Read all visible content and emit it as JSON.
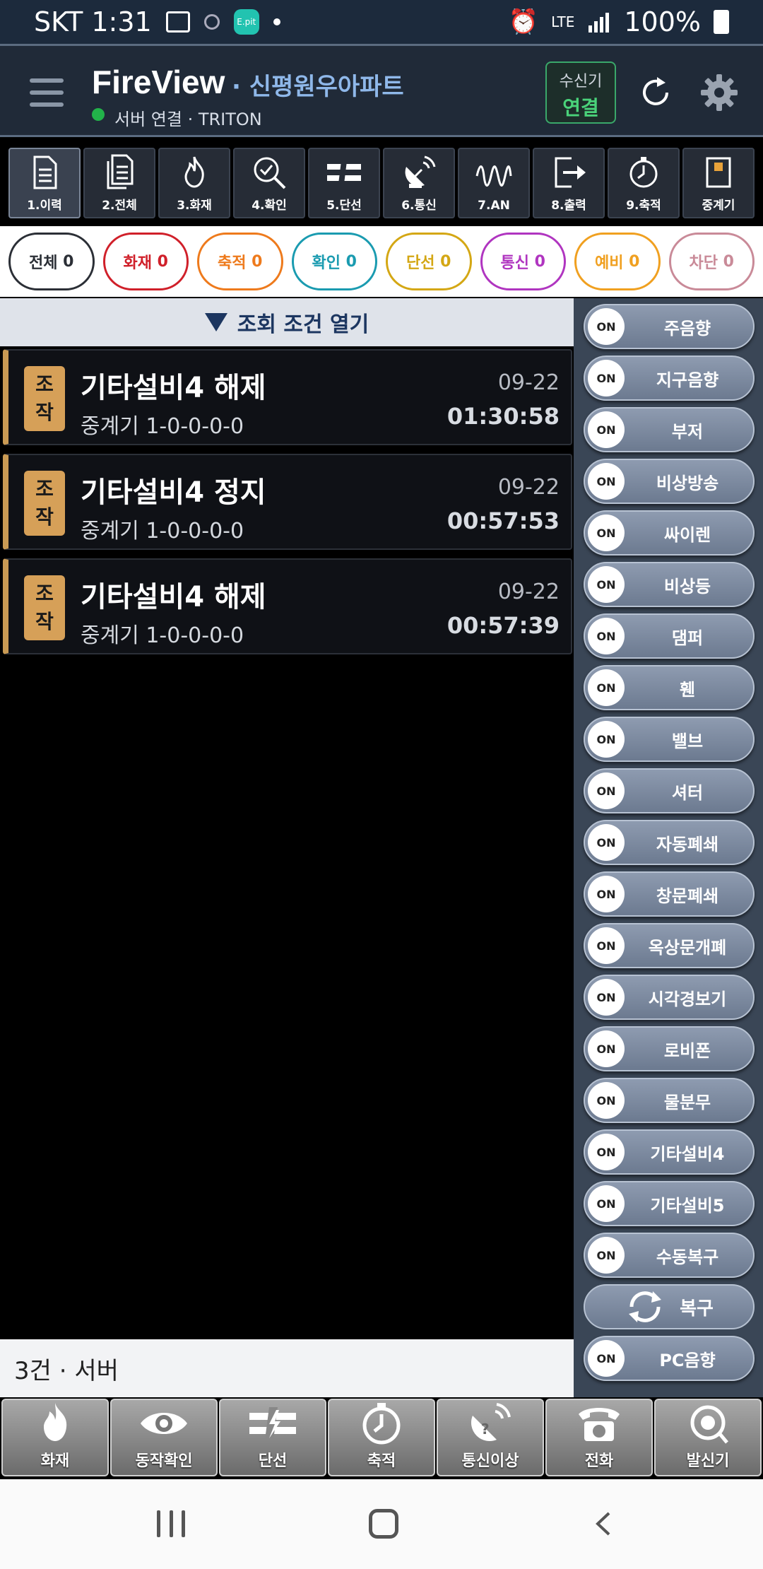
{
  "status_bar": {
    "carrier_time": "SKT 1:31",
    "app_badge": "E.pit",
    "network": "LTE",
    "battery": "100%"
  },
  "header": {
    "title": "FireView",
    "site": "· 신평원우아파트",
    "connection": "서버 연결 · TRITON",
    "receiver_line1": "수신기",
    "receiver_line2": "연결"
  },
  "toolbar": [
    {
      "label": "1.이력",
      "icon": "document-icon",
      "active": true
    },
    {
      "label": "2.전체",
      "icon": "documents-icon",
      "active": false
    },
    {
      "label": "3.화재",
      "icon": "fire-icon",
      "active": false
    },
    {
      "label": "4.확인",
      "icon": "check-search-icon",
      "active": false
    },
    {
      "label": "5.단선",
      "icon": "broken-line-icon",
      "active": false
    },
    {
      "label": "6.통신",
      "icon": "satellite-dish-icon",
      "active": false
    },
    {
      "label": "7.AN",
      "icon": "wave-icon",
      "active": false
    },
    {
      "label": "8.출력",
      "icon": "export-icon",
      "active": false
    },
    {
      "label": "9.축적",
      "icon": "clock-icon",
      "active": false
    },
    {
      "label": "중계기",
      "icon": "repeater-icon",
      "active": false
    }
  ],
  "filters": [
    {
      "name": "전체",
      "count": "0",
      "color": "#2b2f36"
    },
    {
      "name": "화재",
      "count": "0",
      "color": "#d0202a"
    },
    {
      "name": "축적",
      "count": "0",
      "color": "#ee7a1c"
    },
    {
      "name": "확인",
      "count": "0",
      "color": "#1a9bb0"
    },
    {
      "name": "단선",
      "count": "0",
      "color": "#d4a714"
    },
    {
      "name": "통신",
      "count": "0",
      "color": "#b035c0"
    },
    {
      "name": "예비",
      "count": "0",
      "color": "#f0a020"
    },
    {
      "name": "차단",
      "count": "0",
      "color": "#c98a98"
    }
  ],
  "query_bar": "조회 조건 열기",
  "events": [
    {
      "badge": "조작",
      "title": "기타설비4 해제",
      "sub": "중계기 1-0-0-0-0",
      "date": "09-22",
      "time": "01:30:58"
    },
    {
      "badge": "조작",
      "title": "기타설비4 정지",
      "sub": "중계기 1-0-0-0-0",
      "date": "09-22",
      "time": "00:57:53"
    },
    {
      "badge": "조작",
      "title": "기타설비4 해제",
      "sub": "중계기 1-0-0-0-0",
      "date": "09-22",
      "time": "00:57:39"
    }
  ],
  "footer_count": "3건 · 서버",
  "toggles": [
    {
      "state": "ON",
      "label": "주음향"
    },
    {
      "state": "ON",
      "label": "지구음향"
    },
    {
      "state": "ON",
      "label": "부저"
    },
    {
      "state": "ON",
      "label": "비상방송"
    },
    {
      "state": "ON",
      "label": "싸이렌"
    },
    {
      "state": "ON",
      "label": "비상등"
    },
    {
      "state": "ON",
      "label": "댐퍼"
    },
    {
      "state": "ON",
      "label": "휀"
    },
    {
      "state": "ON",
      "label": "밸브"
    },
    {
      "state": "ON",
      "label": "셔터"
    },
    {
      "state": "ON",
      "label": "자동폐쇄"
    },
    {
      "state": "ON",
      "label": "창문폐쇄"
    },
    {
      "state": "ON",
      "label": "옥상문개폐"
    },
    {
      "state": "ON",
      "label": "시각경보기"
    },
    {
      "state": "ON",
      "label": "로비폰"
    },
    {
      "state": "ON",
      "label": "물분무"
    },
    {
      "state": "ON",
      "label": "기타설비4"
    },
    {
      "state": "ON",
      "label": "기타설비5"
    },
    {
      "state": "ON",
      "label": "수동복구"
    }
  ],
  "recover_label": "복구",
  "pc_sound": {
    "state": "ON",
    "label": "PC음향"
  },
  "bottom_nav": [
    {
      "label": "화재",
      "icon": "fire-icon"
    },
    {
      "label": "동작확인",
      "icon": "eye-icon"
    },
    {
      "label": "단선",
      "icon": "broken-line-icon"
    },
    {
      "label": "축적",
      "icon": "clock-icon"
    },
    {
      "label": "통신이상",
      "icon": "signal-question-icon"
    },
    {
      "label": "전화",
      "icon": "telephone-icon"
    },
    {
      "label": "발신기",
      "icon": "alarm-button-icon"
    }
  ]
}
